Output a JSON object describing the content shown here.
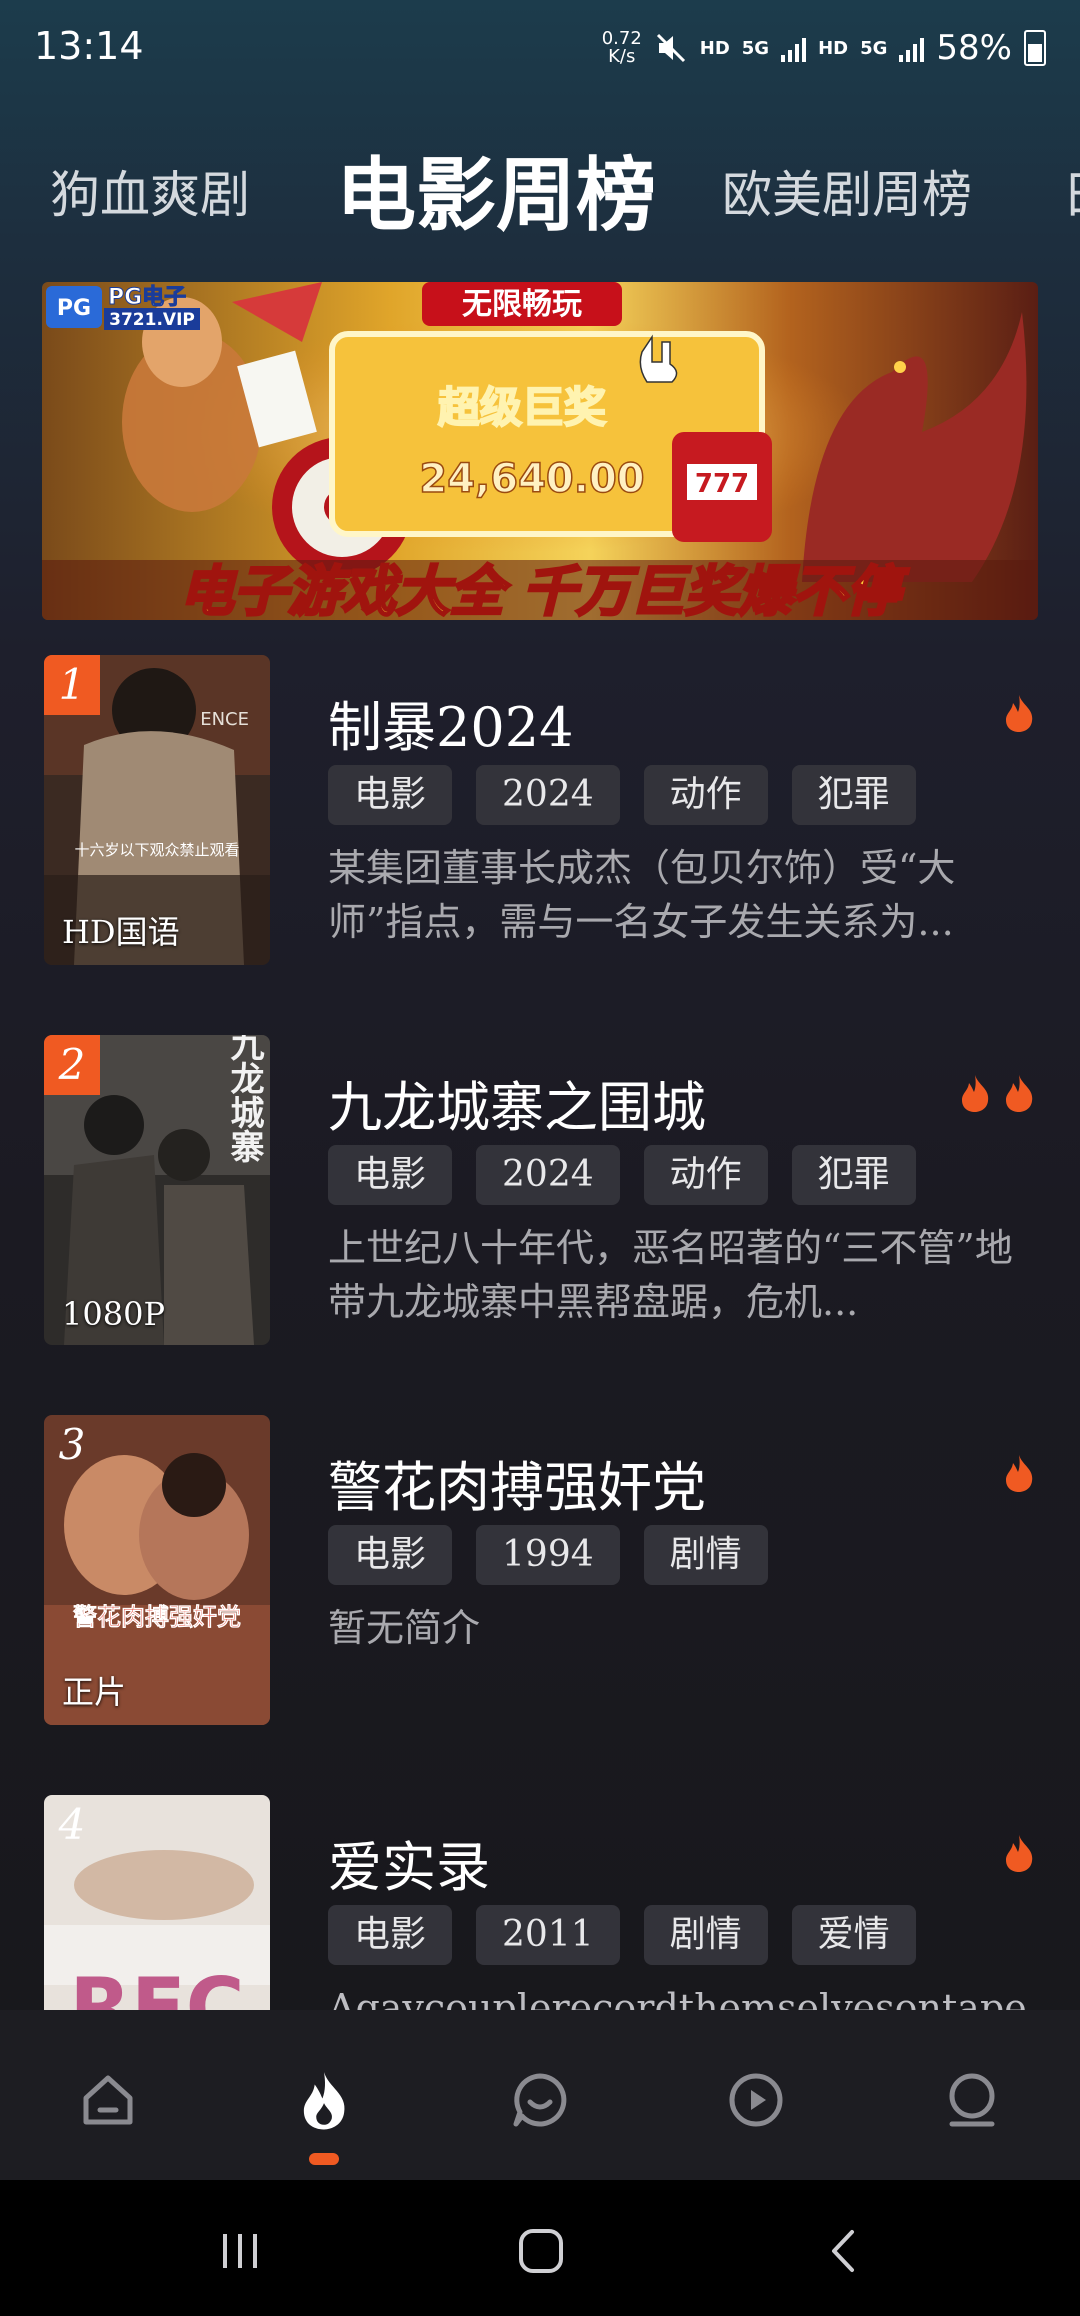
{
  "status_bar": {
    "time": "13:14",
    "net_speed_value": "0.72",
    "net_speed_unit": "K/s",
    "hd1": "HD",
    "five_g1": "5G",
    "hd2": "HD",
    "five_g2": "5G",
    "battery": "58%"
  },
  "tabs": [
    "狗血爽剧",
    "电影周榜",
    "欧美剧周榜",
    "日"
  ],
  "active_tab": "电影周榜",
  "banner": {
    "brand": "PG电子",
    "brand_sub": "3721.VIP",
    "badge": "无限畅玩",
    "jackpot_label": "超级巨奖",
    "jackpot_amount": "24,640.00",
    "slogan": "电子游戏大全 千万巨奖爆不停"
  },
  "list": [
    {
      "rank": "1",
      "quality": "HD国语",
      "title": "制暴2024",
      "tags": [
        "电影",
        "2024",
        "动作",
        "犯罪"
      ],
      "desc": "某集团董事长成杰（包贝尔饰）受“大师”指点，需与一名女子发生关系为...",
      "heat": 1,
      "poster_text": "十六岁以下观众禁止观看"
    },
    {
      "rank": "2",
      "quality": "1080P",
      "title": "九龙城寨之围城",
      "tags": [
        "电影",
        "2024",
        "动作",
        "犯罪"
      ],
      "desc": "上世纪八十年代，恶名昭著的“三不管”地带九龙城寨中黑帮盘踞，危机...",
      "heat": 2,
      "poster_text": "九龙城寨"
    },
    {
      "rank": "3",
      "quality": "正片",
      "title": "警花肉搏强奸党",
      "tags": [
        "电影",
        "1994",
        "剧情"
      ],
      "desc": "暂无简介",
      "heat": 1,
      "poster_text": "警花肉搏强奸党"
    },
    {
      "rank": "4",
      "quality": "",
      "title": "爱实录",
      "tags": [
        "电影",
        "2011",
        "剧情",
        "爱情"
      ],
      "desc": "Agaycouplerecordthemselvesontapeon",
      "heat": 1,
      "poster_text": "REC"
    }
  ],
  "colors": {
    "accent": "#f05a22",
    "tag_bg": "#33333a",
    "nav_bg": "#1d1d22"
  },
  "bottom_nav": [
    "home-icon",
    "flame-icon",
    "chat-icon",
    "play-icon",
    "profile-icon"
  ],
  "system_nav": [
    "recents-icon",
    "home-button-icon",
    "back-icon"
  ]
}
